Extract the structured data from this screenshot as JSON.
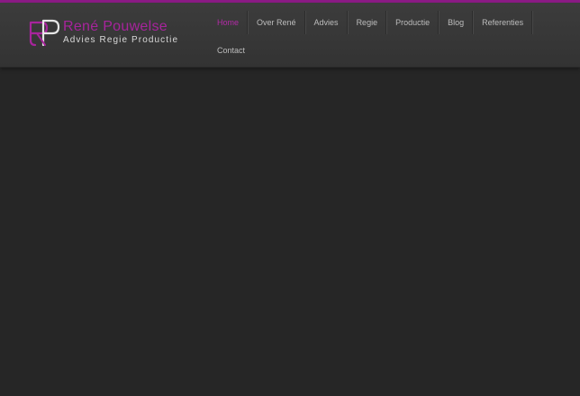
{
  "colors": {
    "accent": "#a7249c",
    "nav_active": "#b32aa7",
    "header_bg": "#383838",
    "page_bg": "#262626"
  },
  "logo": {
    "name": "René Pouwelse",
    "tagline": "Advies Regie Productie",
    "icon": "rp-monogram-logo"
  },
  "nav": {
    "items": [
      {
        "label": "Home",
        "active": true
      },
      {
        "label": "Over René",
        "active": false
      },
      {
        "label": "Advies",
        "active": false
      },
      {
        "label": "Regie",
        "active": false
      },
      {
        "label": "Productie",
        "active": false
      },
      {
        "label": "Blog",
        "active": false
      },
      {
        "label": "Referenties",
        "active": false
      },
      {
        "label": "Contact",
        "active": false
      }
    ]
  }
}
